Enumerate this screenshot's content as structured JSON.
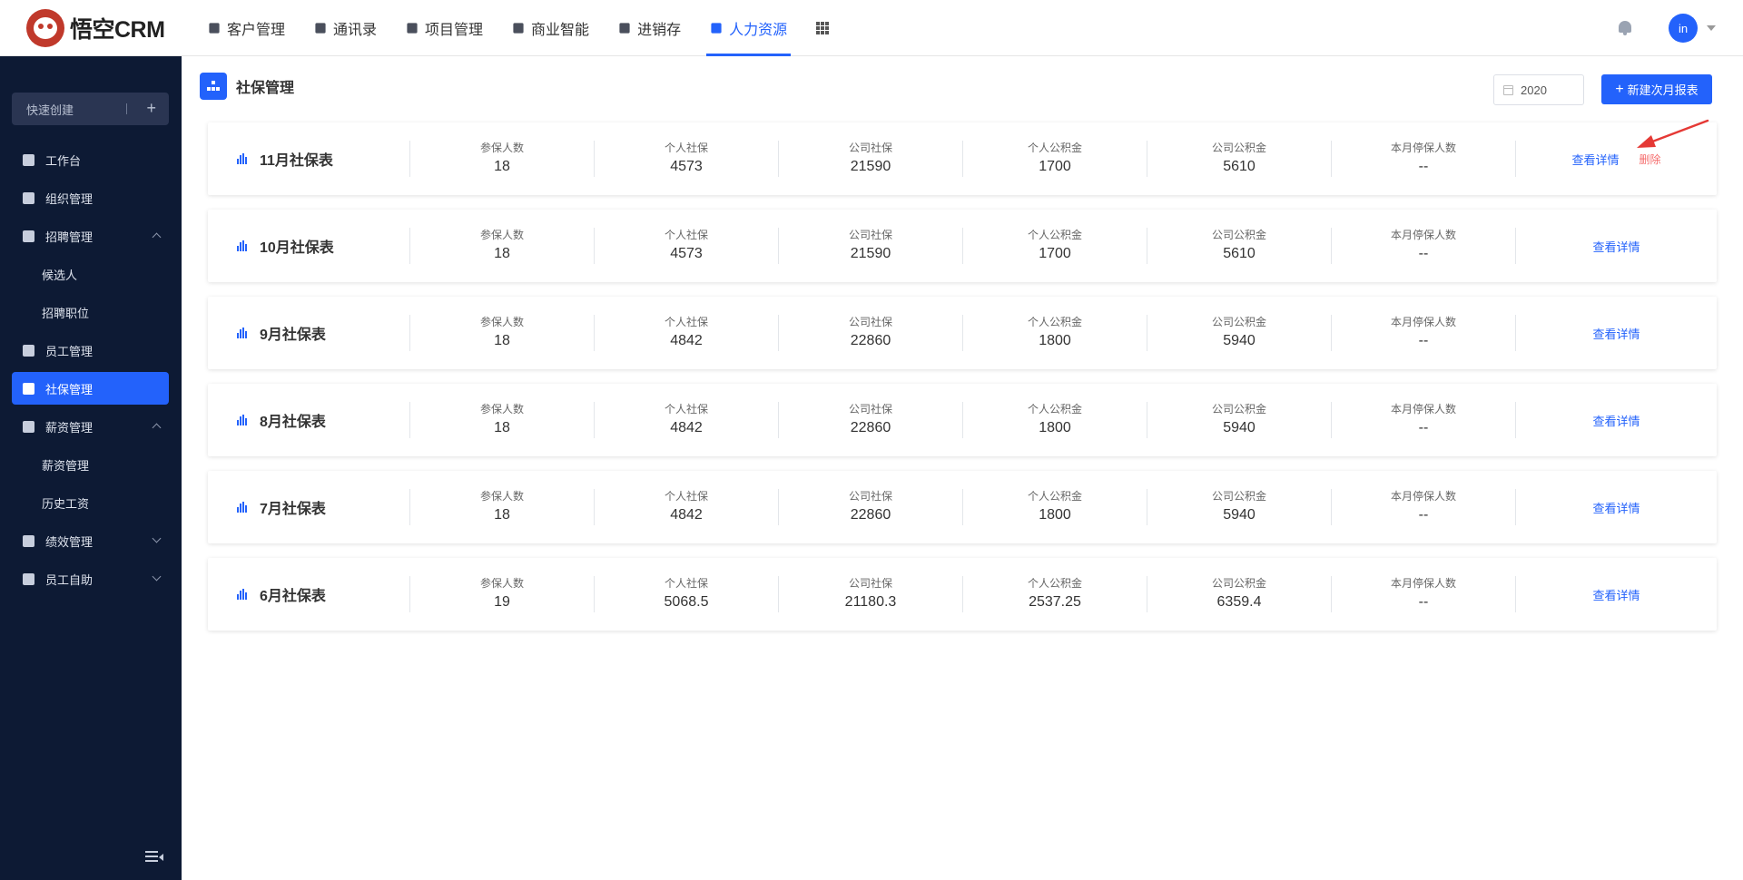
{
  "brand": {
    "name": "悟空CRM"
  },
  "nav": [
    {
      "label": "客户管理",
      "icon": "customer-icon",
      "active": false
    },
    {
      "label": "通讯录",
      "icon": "contacts-icon",
      "active": false
    },
    {
      "label": "项目管理",
      "icon": "project-icon",
      "active": false
    },
    {
      "label": "商业智能",
      "icon": "bi-icon",
      "active": false
    },
    {
      "label": "进销存",
      "icon": "inventory-icon",
      "active": false
    },
    {
      "label": "人力资源",
      "icon": "hr-icon",
      "active": true
    }
  ],
  "user": {
    "avatar_text": "in"
  },
  "sidebar": {
    "quick_create": "快速创建",
    "items": [
      {
        "label": "工作台",
        "type": "item"
      },
      {
        "label": "组织管理",
        "type": "item"
      },
      {
        "label": "招聘管理",
        "type": "group",
        "expanded": true
      },
      {
        "label": "候选人",
        "type": "sub"
      },
      {
        "label": "招聘职位",
        "type": "sub"
      },
      {
        "label": "员工管理",
        "type": "item"
      },
      {
        "label": "社保管理",
        "type": "item",
        "active": true
      },
      {
        "label": "薪资管理",
        "type": "group",
        "expanded": true
      },
      {
        "label": "薪资管理",
        "type": "sub"
      },
      {
        "label": "历史工资",
        "type": "sub"
      },
      {
        "label": "绩效管理",
        "type": "group",
        "expanded": false
      },
      {
        "label": "员工自助",
        "type": "group",
        "expanded": false
      }
    ]
  },
  "page": {
    "title": "社保管理",
    "year": "2020",
    "new_button": "新建次月报表"
  },
  "metric_labels": [
    "参保人数",
    "个人社保",
    "公司社保",
    "个人公积金",
    "公司公积金",
    "本月停保人数"
  ],
  "actions": {
    "detail": "查看详情",
    "delete": "删除"
  },
  "reports": [
    {
      "title": "11月社保表",
      "values": [
        "18",
        "4573",
        "21590",
        "1700",
        "5610",
        "--"
      ],
      "deletable": true
    },
    {
      "title": "10月社保表",
      "values": [
        "18",
        "4573",
        "21590",
        "1700",
        "5610",
        "--"
      ],
      "deletable": false
    },
    {
      "title": "9月社保表",
      "values": [
        "18",
        "4842",
        "22860",
        "1800",
        "5940",
        "--"
      ],
      "deletable": false
    },
    {
      "title": "8月社保表",
      "values": [
        "18",
        "4842",
        "22860",
        "1800",
        "5940",
        "--"
      ],
      "deletable": false
    },
    {
      "title": "7月社保表",
      "values": [
        "18",
        "4842",
        "22860",
        "1800",
        "5940",
        "--"
      ],
      "deletable": false
    },
    {
      "title": "6月社保表",
      "values": [
        "19",
        "5068.5",
        "21180.3",
        "2537.25",
        "6359.4",
        "--"
      ],
      "deletable": false
    }
  ],
  "colors": {
    "primary": "#2362fb",
    "sidebar_bg": "#0d1a34",
    "danger": "#f56c6c",
    "annotation": "#e53935"
  }
}
